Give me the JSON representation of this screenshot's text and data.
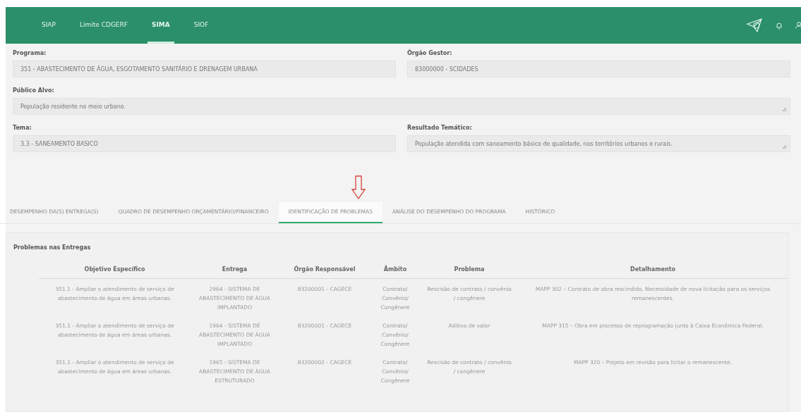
{
  "nav": {
    "items": [
      {
        "label": "SIAP",
        "selected": false
      },
      {
        "label": "Limite CDGERF",
        "selected": false
      },
      {
        "label": "SIMA",
        "selected": true
      },
      {
        "label": "SIOF",
        "selected": false
      }
    ]
  },
  "form": {
    "rows": [
      [
        {
          "label": "Programa:",
          "value": "351 - ABASTECIMENTO DE ÁGUA, ESGOTAMENTO SANITÁRIO E DRENAGEM URBANA",
          "kind": "input"
        },
        {
          "label": "Órgão Gestor:",
          "value": "83000000 - SCIDADES",
          "kind": "input"
        }
      ],
      [
        {
          "label": "Público Alvo:",
          "value": "População residente no meio urbano.",
          "kind": "textarea"
        }
      ],
      [
        {
          "label": "Tema:",
          "value": "3.3 - SANEAMENTO BASICO",
          "kind": "input"
        },
        {
          "label": "Resultado Temático:",
          "value": "População atendida com saneamento básico de qualidade, nos territórios urbanos e rurais.",
          "kind": "textarea"
        }
      ]
    ]
  },
  "tabs": [
    {
      "label": "DESEMPENHO DA(S) ENTREGA(S)",
      "selected": false
    },
    {
      "label": "QUADRO DE DESEMPENHO ORÇAMENTÁRIO/FINANCEIRO",
      "selected": false
    },
    {
      "label": "IDENTIFICAÇÃO DE PROBLEMAS",
      "selected": true
    },
    {
      "label": "ANÁLISE DO DESEMPENHO DO PROGRAMA",
      "selected": false
    },
    {
      "label": "HISTÓRICO",
      "selected": false
    }
  ],
  "panel": {
    "title": "Problemas nas Entregas",
    "table": {
      "columns": [
        "Objetivo Específico",
        "Entrega",
        "Órgão Responsável",
        "Âmbito",
        "Problema",
        "Detalhamento"
      ],
      "rows": [
        [
          "351.1 - Ampliar o atendimento de serviço de abastecimento de água em áreas urbanas.",
          "2964 - SISTEMA DE ABASTECIMENTO DE ÁGUA IMPLANTADO",
          "83200001 - CAGECE",
          "Contrato/ Convênio/ Congênere",
          "Rescisão de contrato / convênio / congênere",
          "MAPP 302 – Contrato de obra rescindido. Necessidade de nova licitação para os serviços remanescentes."
        ],
        [
          "351.1 - Ampliar o atendimento de serviço de abastecimento de água em áreas urbanas.",
          "1964 - SISTEMA DE ABASTECIMENTO DE ÁGUA IMPLANTADO",
          "83200001 - CAGECE",
          "Contrato/ Convênio/ Congênere",
          "Aditivo de valor",
          "MAPP 315 – Obra em processo de reprogramação junto à Caixa Econômica Federal."
        ],
        [
          "351.1 - Ampliar o atendimento de serviço de abastecimento de água em áreas urbanas.",
          "1965 - SISTEMA DE ABASTECIMENTO DE ÁGUA ESTRUTURADO",
          "83200002 - CAGECE",
          "Contrato/ Convênio/ Congênere",
          "Rescisão de contrato / convênio / congênere",
          "MAPP 320 – Projeto em revisão para licitar o remanescente."
        ]
      ]
    }
  }
}
